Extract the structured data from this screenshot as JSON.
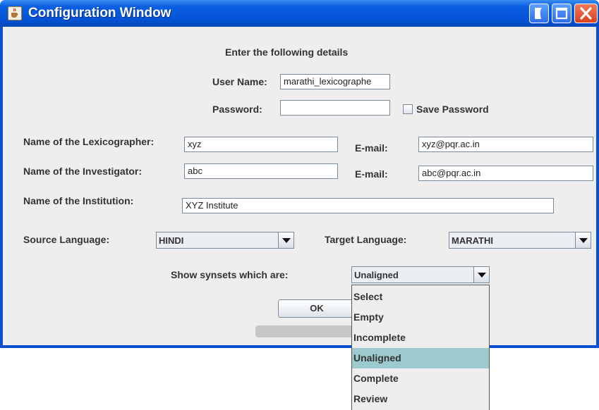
{
  "window": {
    "title": "Configuration Window",
    "icons": {
      "app": "java-cup-icon",
      "minimize": "minimize-icon",
      "maximize": "maximize-icon",
      "close": "close-icon"
    }
  },
  "form": {
    "heading": "Enter the following details",
    "user_name_label": "User Name:",
    "user_name_value": "marathi_lexicographe",
    "password_label": "Password:",
    "password_value": "",
    "save_password_label": "Save Password",
    "lexicographer_label": "Name of the Lexicographer:",
    "lexicographer_value": "xyz",
    "lexicographer_email_label": "E-mail:",
    "lexicographer_email_value": "xyz@pqr.ac.in",
    "investigator_label": "Name of the Investigator:",
    "investigator_value": "abc",
    "investigator_email_label": "E-mail:",
    "investigator_email_value": "abc@pqr.ac.in",
    "institution_label": "Name of the Institution:",
    "institution_value": "XYZ Institute",
    "source_language_label": "Source Language:",
    "source_language_value": "HINDI",
    "target_language_label": "Target Language:",
    "target_language_value": "MARATHI",
    "synsets_label": "Show synsets which are:",
    "synsets_value": "Unaligned",
    "ok_label": "OK"
  },
  "dropdown": {
    "options": [
      "Select",
      "Empty",
      "Incomplete",
      "Unaligned",
      "Complete",
      "Review"
    ],
    "selected": "Unaligned",
    "highlight_color": "#9ccace"
  },
  "colors": {
    "titlebar": "#0554d8",
    "window_bg": "#eeeeee",
    "close_button": "#d8411d"
  }
}
